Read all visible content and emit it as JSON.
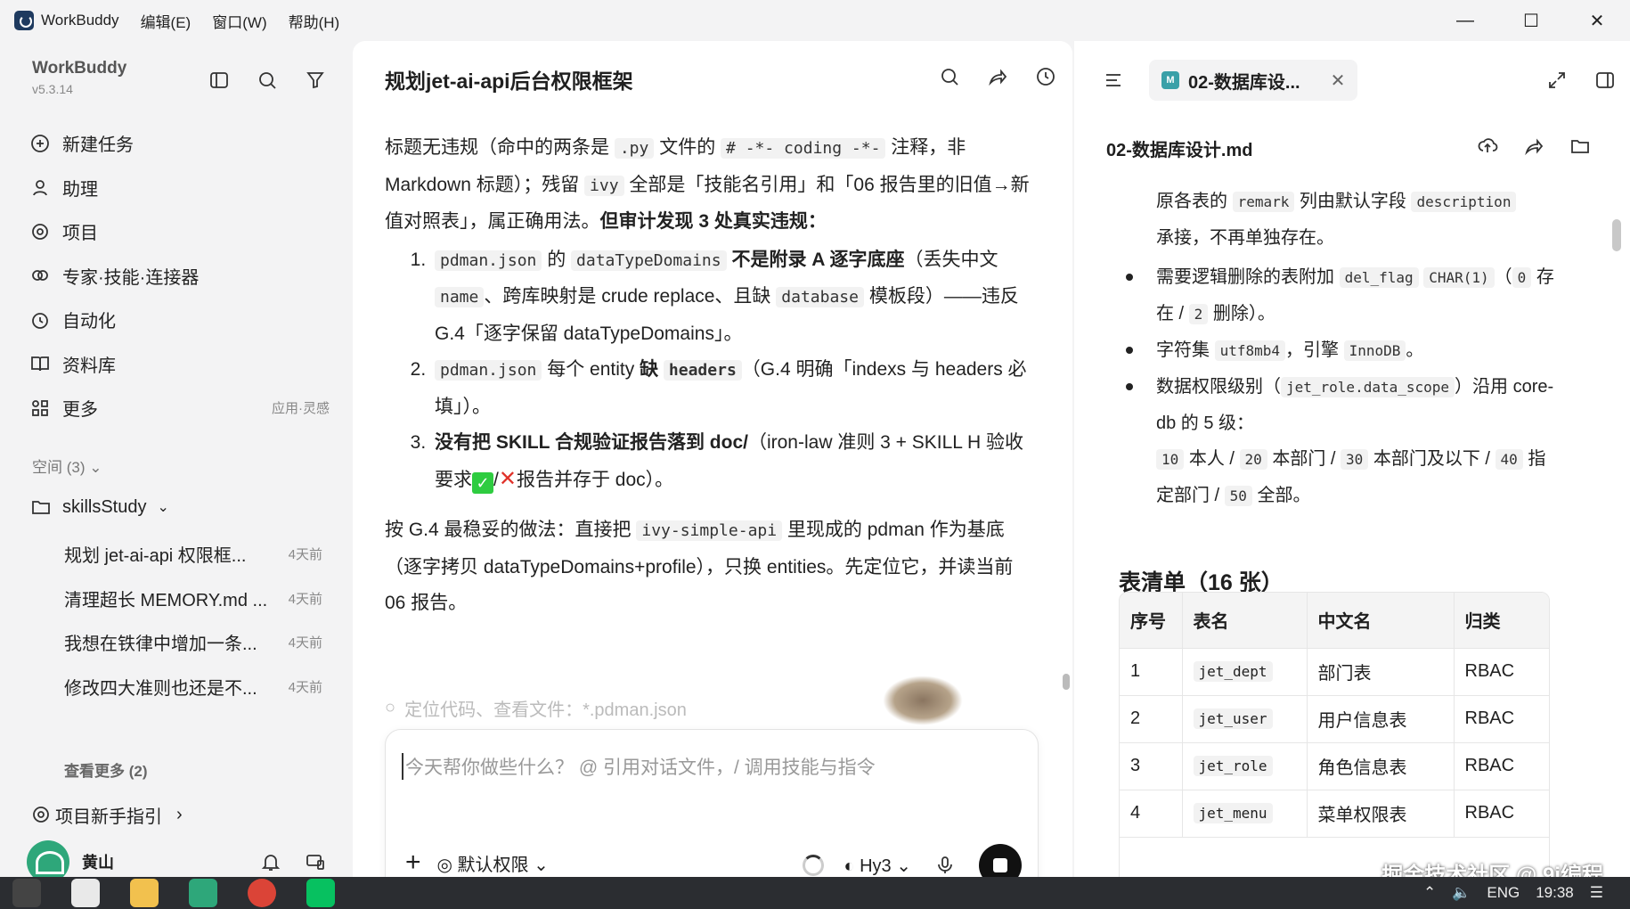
{
  "menubar": {
    "app": "WorkBuddy",
    "menus": [
      "编辑(E)",
      "窗口(W)",
      "帮助(H)"
    ]
  },
  "sidebar": {
    "brand": "WorkBuddy",
    "version": "v5.3.14",
    "nav": [
      {
        "label": "新建任务",
        "icon": "plus-circle-icon"
      },
      {
        "label": "助理",
        "icon": "assistant-icon"
      },
      {
        "label": "项目",
        "icon": "project-icon"
      },
      {
        "label": "专家·技能·连接器",
        "icon": "expert-icon"
      },
      {
        "label": "自动化",
        "icon": "automation-icon"
      },
      {
        "label": "资料库",
        "icon": "book-icon"
      },
      {
        "label": "更多",
        "icon": "grid-icon",
        "hint": "应用·灵感"
      }
    ],
    "space_header": "空间 (3)",
    "folder": "skillsStudy",
    "conversations": [
      {
        "title": "规划 jet-ai-api 权限框...",
        "time": "4天前"
      },
      {
        "title": "清理超长 MEMORY.md ...",
        "time": "4天前"
      },
      {
        "title": "我想在铁律中增加一条...",
        "time": "4天前"
      },
      {
        "title": "修改四大准则也还是不...",
        "time": "4天前"
      }
    ],
    "see_more": "查看更多 (2)",
    "guide": "项目新手指引",
    "user": "黄山"
  },
  "chat": {
    "title": "规划jet-ai-api后台权限框架",
    "p1": {
      "a": "标题无违规（命中的两条是 ",
      "c1": ".py",
      "b": " 文件的 ",
      "c2": "# -*- coding -*-",
      "c": " 注释，非 Markdown 标题）；残留 ",
      "c3": "ivy",
      "d": " 全部是「技能名引用」和「06 报告里的旧值→新值对照表」，属正确用法。",
      "bold": "但审计发现 3 处真实违规："
    },
    "items": [
      {
        "c1": "pdman.json",
        "t1": " 的 ",
        "c2": "dataTypeDomains",
        "bold": " 不是附录 A 逐字底座",
        "t2": "（丢失中文 ",
        "c3": "name",
        "t3": "、跨库映射是 crude replace、且缺 ",
        "c4": "database",
        "t4": " 模板段）——违反 G.4「逐字保留 dataTypeDomains」。"
      },
      {
        "c1": "pdman.json",
        "t1": " 每个 entity ",
        "bold": "缺 ",
        "c2": "headers",
        "t2": "（G.4 明确「indexs 与 headers 必填」）。"
      },
      {
        "bold": "没有把 SKILL 合规验证报告落到 doc/",
        "t1": "（iron-law 准则 3 + SKILL H 验收要求",
        "sep": "/",
        "t2": "报告并存于 doc）。"
      }
    ],
    "p2": {
      "a": "按 G.4 最稳妥的做法：直接把 ",
      "c1": "ivy-simple-api",
      "b": " 里现成的 pdman 作为基底（逐字拷贝 dataTypeDomains+profile），只换 entities。先定位它，并读当前 06 报告。"
    },
    "search_hint": "定位代码、查看文件：*.pdman.json",
    "input_placeholder": "今天帮你做些什么？ @ 引用对话文件，/ 调用技能与指令",
    "permission": "默认权限",
    "model": "Hy3"
  },
  "doc": {
    "tab_title": "02-数据库设...",
    "tab_badge": "M",
    "filename": "02-数据库设计.md",
    "line1": {
      "a": "原各表的 ",
      "c1": "remark",
      "b": " 列由默认字段 ",
      "c2": "description"
    },
    "line1b": "承接，不再单独存在。",
    "bullets": [
      {
        "a": "需要逻辑删除的表附加 ",
        "c1": "del_flag",
        "b": " ",
        "c2": "CHAR(1)",
        "c": "（",
        "c3": "0",
        "d": " 存在 / ",
        "c4": "2",
        "e": " 删除）。"
      },
      {
        "a": "字符集 ",
        "c1": "utf8mb4",
        "b": "，引擎 ",
        "c2": "InnoDB",
        "c": "。"
      },
      {
        "a": "数据权限级别（",
        "c1": "jet_role.data_scope",
        "b": "）沿用 core-db 的 5 级："
      }
    ],
    "scope": {
      "c1": "10",
      "a": " 本人 / ",
      "c2": "20",
      "b": " 本部门 / ",
      "c3": "30",
      "c": " 本部门及以下 / ",
      "c4": "40",
      "d": " 指定部门 / ",
      "c5": "50",
      "e": " 全部。"
    },
    "h2": "表清单（16 张）",
    "table": {
      "headers": [
        "序号",
        "表名",
        "中文名",
        "归类"
      ],
      "rows": [
        [
          "1",
          "jet_dept",
          "部门表",
          "RBAC"
        ],
        [
          "2",
          "jet_user",
          "用户信息表",
          "RBAC"
        ],
        [
          "3",
          "jet_role",
          "角色信息表",
          "RBAC"
        ],
        [
          "4",
          "jet_menu",
          "菜单权限表",
          "RBAC"
        ]
      ]
    },
    "watermark": "掘金技术社区 @ 9i编程"
  },
  "taskbar": {
    "time": "19:38",
    "lang": "ENG"
  }
}
